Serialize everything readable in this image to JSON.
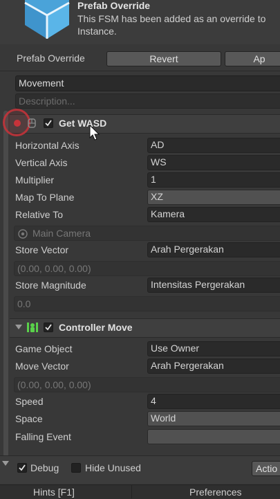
{
  "prefab": {
    "title": "Prefab Override",
    "message_line1": "This FSM has been added as an override to",
    "message_line2": "Instance.",
    "override_label": "Prefab Override",
    "revert_label": "Revert",
    "apply_label": "Ap"
  },
  "state": {
    "name_value": "Movement",
    "description_placeholder": "Description..."
  },
  "get_wasd": {
    "title": "Get WASD",
    "fields": [
      {
        "label": "Horizontal Axis",
        "value": "AD"
      },
      {
        "label": "Vertical Axis",
        "value": "WS"
      },
      {
        "label": "Multiplier",
        "value": "1"
      },
      {
        "label": "Map To Plane",
        "value": "XZ"
      },
      {
        "label": "Relative To",
        "value": "Kamera"
      }
    ],
    "relative_hint": "Main Camera",
    "store_vector_label": "Store Vector",
    "store_vector_value": "Arah Pergerakan",
    "store_vector_readout": "(0.00, 0.00, 0.00)",
    "store_magnitude_label": "Store Magnitude",
    "store_magnitude_value": "Intensitas Pergerakan",
    "store_magnitude_readout": "0.0"
  },
  "controller_move": {
    "title": "Controller Move",
    "game_object_label": "Game Object",
    "game_object_value": "Use Owner",
    "move_vector_label": "Move Vector",
    "move_vector_value": "Arah Pergerakan",
    "move_vector_readout": "(0.00, 0.00, 0.00)",
    "speed_label": "Speed",
    "speed_value": "4",
    "space_label": "Space",
    "space_value": "World",
    "falling_event_label": "Falling Event",
    "falling_event_value": ""
  },
  "footer": {
    "debug_label": "Debug",
    "hide_unused_label": "Hide Unused",
    "action_label": "Actio",
    "hints_label": "Hints [F1]",
    "preferences_label": "Preferences"
  },
  "colors": {
    "background": "#383838",
    "field": "#2a2a2a",
    "breakpoint_red": "#c8333a",
    "controller_icon_green": "#59d14a"
  },
  "icons": [
    "prefab-cube-icon",
    "breakpoint-icon",
    "script-icon",
    "controller-icon",
    "camera-icon",
    "foldout-arrow-icon",
    "cursor-icon"
  ]
}
